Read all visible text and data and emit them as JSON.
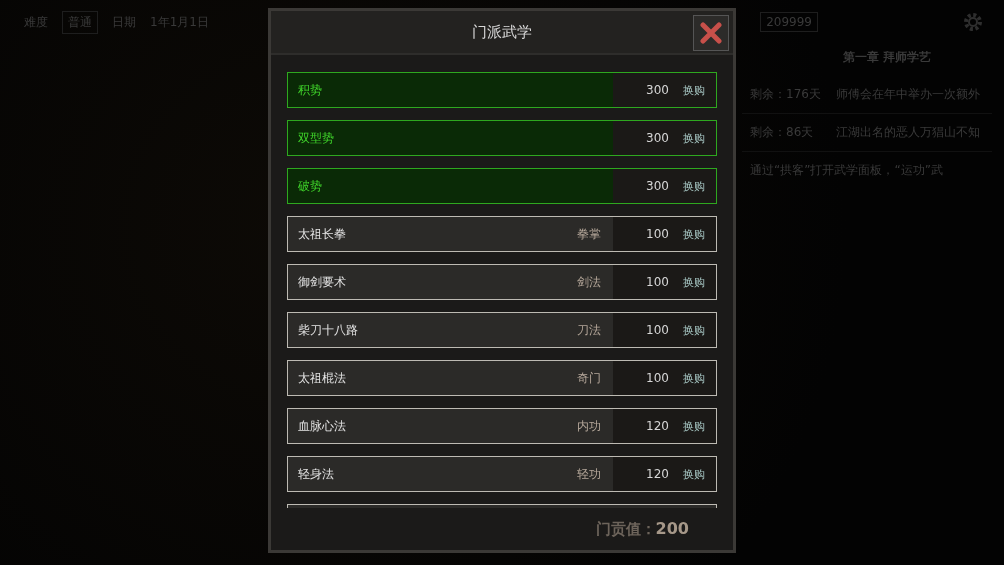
{
  "top_bar": {
    "difficulty_label": "难度",
    "difficulty": "普通",
    "date_label": "日期",
    "date": "1年1月1日",
    "money": "209999"
  },
  "quest_panel": {
    "chapter": "第一章 拜师学艺",
    "quests": [
      {
        "remaining": "剩余：176天",
        "text": "师傅会在年中举办一次额外"
      },
      {
        "remaining": "剩余：86天",
        "text": "江湖出名的恶人万猖山不知"
      }
    ],
    "hint": "通过“拱客”打开武学面板，“运功”武"
  },
  "dialog": {
    "title": "门派武学",
    "items": [
      {
        "name": "积势",
        "cost": "300",
        "button": "换购",
        "selected": true
      },
      {
        "name": "双型势",
        "cost": "300",
        "button": "换购",
        "selected": true
      },
      {
        "name": "破势",
        "cost": "300",
        "button": "换购",
        "selected": true
      },
      {
        "name": "太祖长拳",
        "category": "拳掌",
        "cost": "100",
        "button": "换购",
        "selected": false
      },
      {
        "name": "御剑要术",
        "category": "剑法",
        "cost": "100",
        "button": "换购",
        "selected": false
      },
      {
        "name": "柴刀十八路",
        "category": "刀法",
        "cost": "100",
        "button": "换购",
        "selected": false
      },
      {
        "name": "太祖棍法",
        "category": "奇门",
        "cost": "100",
        "button": "换购",
        "selected": false
      },
      {
        "name": "血脉心法",
        "category": "内功",
        "cost": "120",
        "button": "换购",
        "selected": false
      },
      {
        "name": "轻身法",
        "category": "轻功",
        "cost": "120",
        "button": "换购",
        "selected": false
      }
    ],
    "contribution_label": "门贡值：",
    "contribution": "200"
  }
}
